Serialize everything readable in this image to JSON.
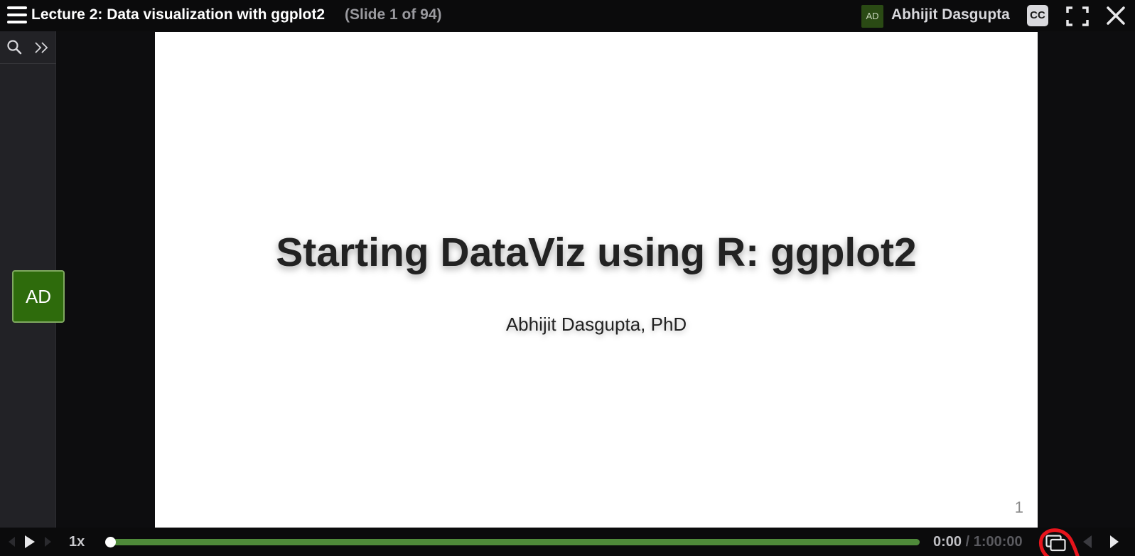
{
  "header": {
    "title": "Lecture 2: Data visualization with ggplot2",
    "slide_count": "(Slide 1 of 94)",
    "avatar_initials": "AD",
    "presenter_name": "Abhijit Dasgupta",
    "cc_label": "CC"
  },
  "sidebar": {
    "avatar_initials": "AD"
  },
  "slide": {
    "title": "Starting DataViz using R: ggplot2",
    "author": "Abhijit Dasgupta, PhD",
    "number": "1"
  },
  "player": {
    "speed": "1x",
    "current_time": "0:00",
    "separator": "/",
    "duration": "1:00:00",
    "progress_fraction": 0.0
  },
  "colors": {
    "accent_green": "#4f8a3a",
    "avatar_green": "#2e6b0c",
    "annotation_red": "#e8141c"
  },
  "icons": [
    "menu-icon",
    "cc-icon",
    "fullscreen-icon",
    "close-icon",
    "search-icon",
    "expand-icon",
    "play-icon",
    "pip-icon",
    "previous-icon",
    "next-icon"
  ]
}
